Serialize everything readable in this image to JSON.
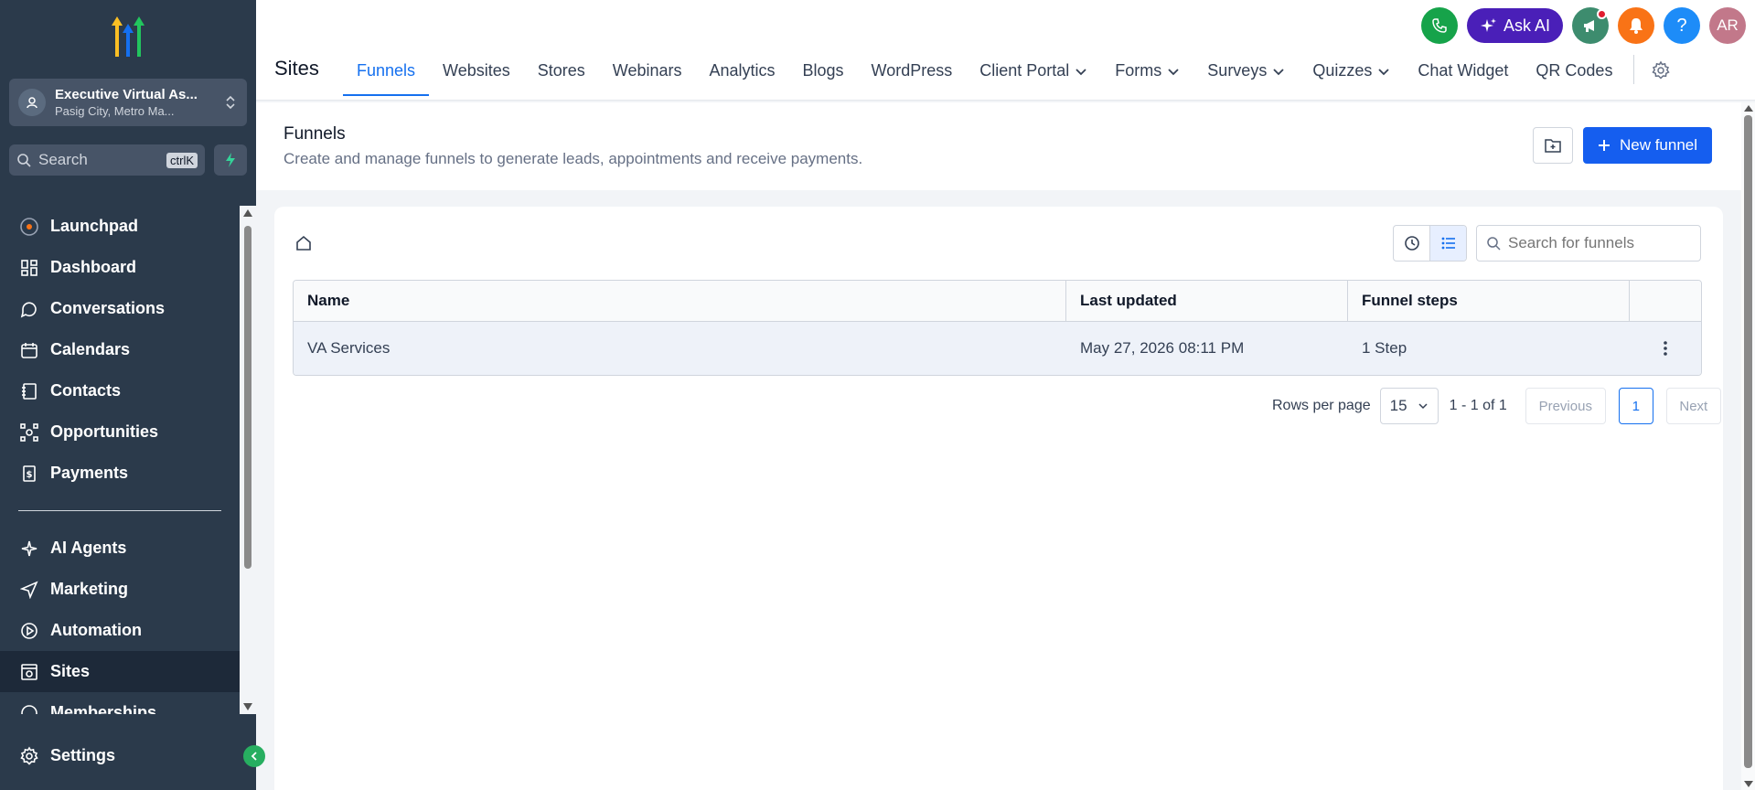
{
  "sidebar": {
    "account": {
      "name": "Executive Virtual As...",
      "location": "Pasig City, Metro Ma..."
    },
    "search": {
      "placeholder": "Search",
      "shortcut": "ctrlK"
    },
    "items": [
      {
        "label": "Launchpad",
        "icon": "launchpad-icon"
      },
      {
        "label": "Dashboard",
        "icon": "dashboard-icon"
      },
      {
        "label": "Conversations",
        "icon": "chat-icon"
      },
      {
        "label": "Calendars",
        "icon": "calendar-icon"
      },
      {
        "label": "Contacts",
        "icon": "contacts-icon"
      },
      {
        "label": "Opportunities",
        "icon": "opportunities-icon"
      },
      {
        "label": "Payments",
        "icon": "payments-icon"
      }
    ],
    "items2": [
      {
        "label": "AI Agents",
        "icon": "sparkle-icon"
      },
      {
        "label": "Marketing",
        "icon": "send-icon"
      },
      {
        "label": "Automation",
        "icon": "automation-icon"
      },
      {
        "label": "Sites",
        "icon": "sites-icon",
        "active": true
      },
      {
        "label": "Memberships",
        "icon": "memberships-icon"
      }
    ],
    "settings_label": "Settings"
  },
  "topbar": {
    "ask_ai": "Ask AI",
    "avatar_initials": "AR",
    "help": "?"
  },
  "header": {
    "title": "Sites",
    "tabs": [
      {
        "label": "Funnels",
        "active": true
      },
      {
        "label": "Websites"
      },
      {
        "label": "Stores"
      },
      {
        "label": "Webinars"
      },
      {
        "label": "Analytics"
      },
      {
        "label": "Blogs"
      },
      {
        "label": "WordPress"
      },
      {
        "label": "Client Portal",
        "dropdown": true
      },
      {
        "label": "Forms",
        "dropdown": true
      },
      {
        "label": "Surveys",
        "dropdown": true
      },
      {
        "label": "Quizzes",
        "dropdown": true
      },
      {
        "label": "Chat Widget"
      },
      {
        "label": "QR Codes"
      }
    ]
  },
  "page": {
    "title": "Funnels",
    "subtitle": "Create and manage funnels to generate leads, appointments and receive payments.",
    "new_button": "New funnel",
    "search_placeholder": "Search for funnels"
  },
  "table": {
    "columns": [
      "Name",
      "Last updated",
      "Funnel steps",
      ""
    ],
    "rows": [
      {
        "name": "VA Services",
        "updated": "May 27, 2026 08:11 PM",
        "steps": "1 Step"
      }
    ]
  },
  "pagination": {
    "rows_per_page_label": "Rows per page",
    "rows_per_page": "15",
    "range": "1 - 1 of 1",
    "previous": "Previous",
    "page": "1",
    "next": "Next"
  },
  "colors": {
    "sidebar_bg": "#2b3a4b",
    "accent": "#1570ef",
    "primary_button": "#155eef",
    "ask_ai": "#4a1fb8",
    "phone": "#16a34a",
    "megaphone": "#3d8c6e",
    "bell": "#f97316",
    "help": "#1d8cf8",
    "avatar": "#c2788a"
  }
}
